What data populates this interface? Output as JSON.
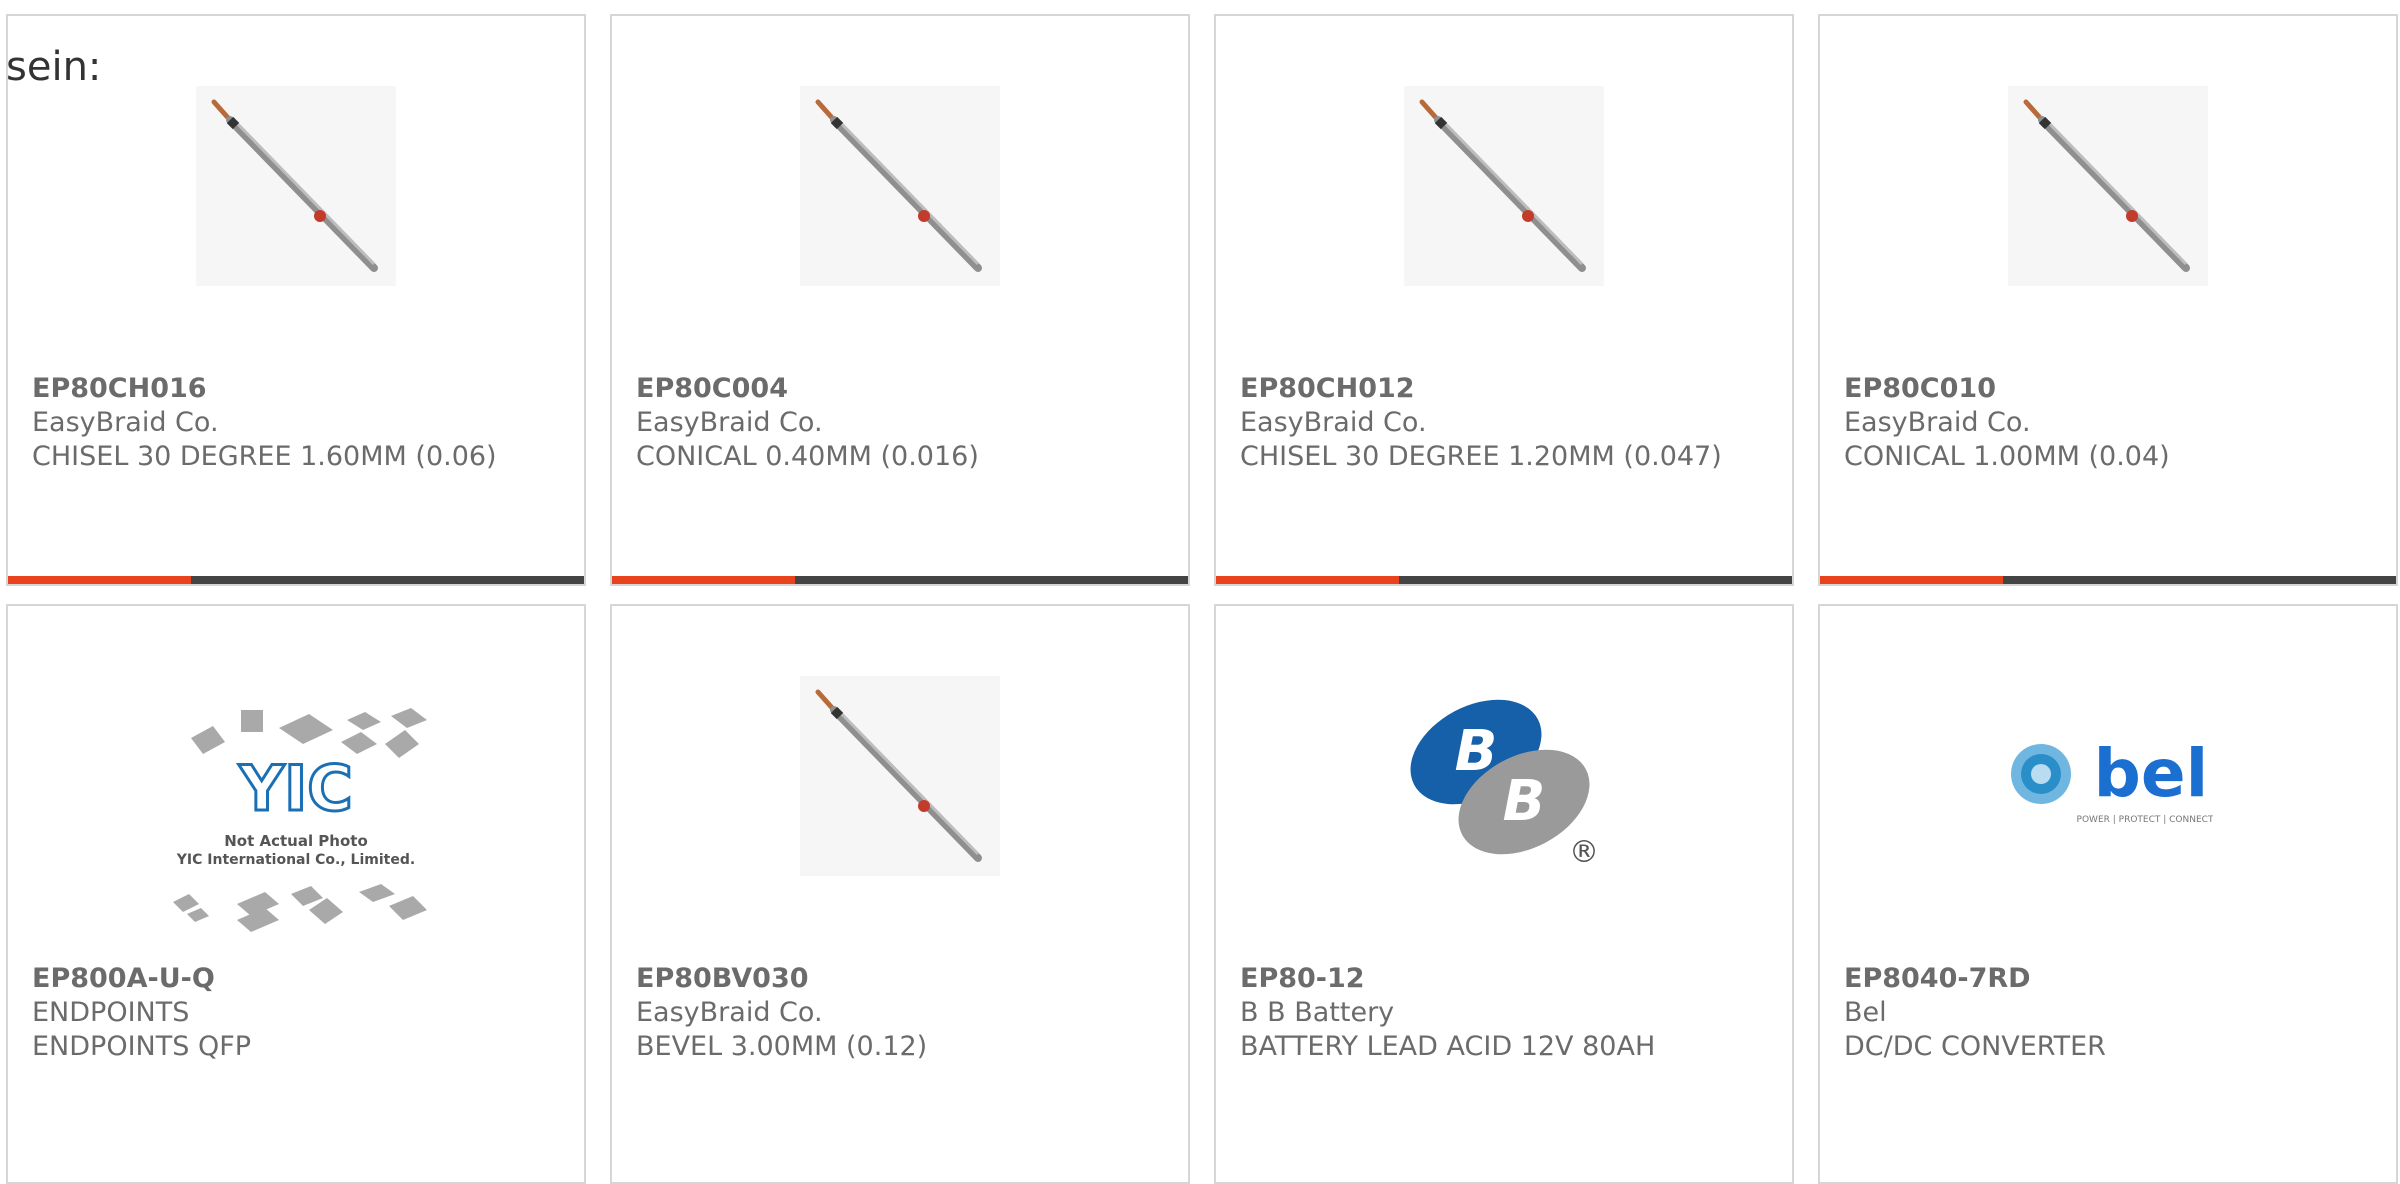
{
  "page": {
    "fragment_text": "sein:"
  },
  "colors": {
    "accent": "#e8431c",
    "bar_dark": "#444444",
    "text": "#6b6b6b",
    "card_border": "#d6d6d6",
    "bb_blue": "#1560a8",
    "bel_blue": "#1a6fd0"
  },
  "cards": [
    {
      "part_number": "EP80CH016",
      "manufacturer": "EasyBraid Co.",
      "description": "CHISEL 30 DEGREE 1.60MM (0.06)",
      "image": "soldering-tip-icon",
      "has_bar": true
    },
    {
      "part_number": "EP80C004",
      "manufacturer": "EasyBraid Co.",
      "description": "CONICAL 0.40MM (0.016)",
      "image": "soldering-tip-icon",
      "has_bar": true
    },
    {
      "part_number": "EP80CH012",
      "manufacturer": "EasyBraid Co.",
      "description": "CHISEL 30 DEGREE 1.20MM (0.047)",
      "image": "soldering-tip-icon",
      "has_bar": true
    },
    {
      "part_number": "EP80C010",
      "manufacturer": "EasyBraid Co.",
      "description": "CONICAL 1.00MM (0.04)",
      "image": "soldering-tip-icon",
      "has_bar": true
    },
    {
      "part_number": "EP800A-U-Q",
      "manufacturer": "ENDPOINTS",
      "description": "ENDPOINTS QFP",
      "image": "yic-placeholder-icon",
      "has_bar": false,
      "placeholder": {
        "logo": "YIC",
        "line1": "Not Actual Photo",
        "line2": "YIC International Co., Limited."
      }
    },
    {
      "part_number": "EP80BV030",
      "manufacturer": "EasyBraid Co.",
      "description": "BEVEL 3.00MM (0.12)",
      "image": "soldering-tip-icon",
      "has_bar": false
    },
    {
      "part_number": "EP80-12",
      "manufacturer": "B B Battery",
      "description": "BATTERY LEAD ACID 12V 80AH",
      "image": "bb-battery-logo-icon",
      "has_bar": false,
      "logo": {
        "letter1": "B",
        "letter2": "B",
        "mark": "®"
      }
    },
    {
      "part_number": "EP8040-7RD",
      "manufacturer": "Bel",
      "description": "DC/DC CONVERTER",
      "image": "bel-logo-icon",
      "has_bar": false,
      "logo": {
        "wordmark": "bel",
        "tagline": "POWER | PROTECT | CONNECT"
      }
    }
  ]
}
